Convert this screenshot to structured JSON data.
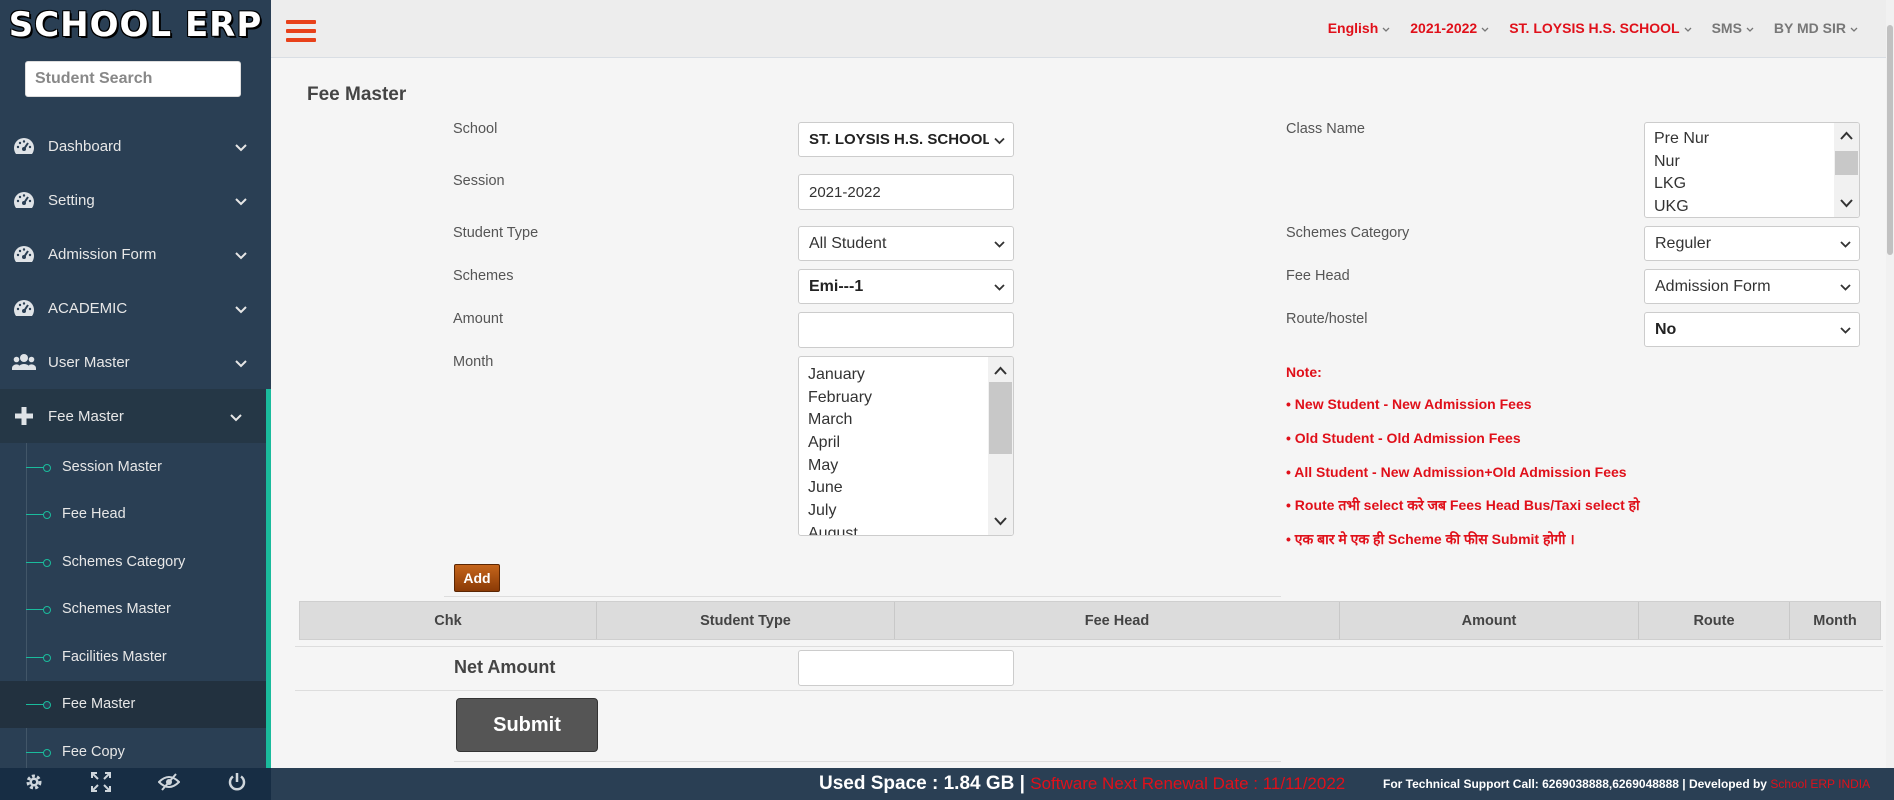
{
  "app": {
    "logo": "SCHOOL ERP"
  },
  "search": {
    "placeholder": "Student Search"
  },
  "sidebar": {
    "items": [
      {
        "label": "Dashboard",
        "icon": "dashboard-icon"
      },
      {
        "label": "Setting",
        "icon": "dashboard-icon"
      },
      {
        "label": "Admission Form",
        "icon": "dashboard-icon"
      },
      {
        "label": "ACADEMIC",
        "icon": "dashboard-icon"
      },
      {
        "label": "User Master",
        "icon": "users-icon"
      },
      {
        "label": "Fee Master",
        "icon": "plus-icon"
      }
    ],
    "sub_items": [
      {
        "label": "Session Master"
      },
      {
        "label": "Fee Head"
      },
      {
        "label": "Schemes Category"
      },
      {
        "label": "Schemes Master"
      },
      {
        "label": "Facilities Master"
      },
      {
        "label": "Fee Master"
      },
      {
        "label": "Fee Copy"
      }
    ]
  },
  "topnav": {
    "language": "English",
    "session": "2021-2022",
    "school": "ST. LOYSIS H.S. SCHOOL",
    "sms": "SMS",
    "user": "BY MD SIR"
  },
  "page": {
    "title": "Fee Master"
  },
  "form": {
    "school_label": "School",
    "school_value": "ST. LOYSIS H.S. SCHOOL",
    "session_label": "Session",
    "session_value": "2021-2022",
    "student_type_label": "Student Type",
    "student_type_value": "All Student",
    "schemes_label": "Schemes",
    "schemes_value": "Emi---1",
    "amount_label": "Amount",
    "amount_value": "",
    "month_label": "Month",
    "months": [
      "January",
      "February",
      "March",
      "April",
      "May",
      "June",
      "July",
      "August"
    ],
    "class_label": "Class Name",
    "classes": [
      "Pre Nur",
      "Nur",
      "LKG",
      "UKG"
    ],
    "schemes_category_label": "Schemes Category",
    "schemes_category_value": "Reguler",
    "fee_head_label": "Fee Head",
    "fee_head_value": "Admission Form",
    "route_label": "Route/hostel",
    "route_value": "No",
    "add_label": "Add",
    "net_amount_label": "Net Amount",
    "net_amount_value": "",
    "submit_label": "Submit"
  },
  "notes": [
    "Note:",
    "• New Student - New Admission Fees",
    "• Old Student - Old Admission Fees",
    "• All Student - New Admission+Old Admission Fees",
    "• Route तभी select करे जब Fees Head Bus/Taxi select हो",
    "• एक बार मे एक ही Scheme की फीस Submit होगी ।"
  ],
  "table": {
    "headers": [
      "Chk",
      "Student Type",
      "Fee Head",
      "Amount",
      "Route",
      "Month"
    ]
  },
  "footer": {
    "used_space": "Used Space : 1.84 GB |",
    "renewal": "Software Next Renewal Date : 11/11/2022",
    "support": "For Technical Support Call: 6269038888,6269048888 | Developed by",
    "developer": "School ERP INDIA"
  },
  "colors": {
    "sidebar_bg": "#2a3f54",
    "accent": "#1abb9c",
    "brand_red": "#e0101a",
    "hamburger": "#e8411a"
  }
}
